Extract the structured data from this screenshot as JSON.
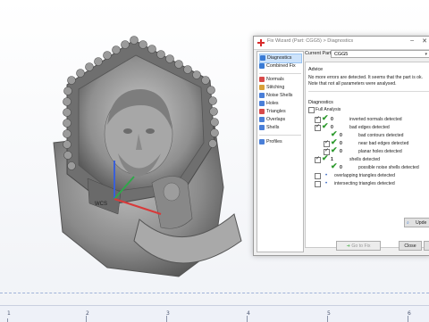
{
  "dialog": {
    "title": "Fix Wizard (Part: CGG5) > Diagnostics",
    "minimize": "–",
    "close": "✕"
  },
  "nav": {
    "items": [
      {
        "label": "Diagnostics",
        "selected": true,
        "color": "#3a7bd5"
      },
      {
        "label": "Combined Fix",
        "color": "#3a7bd5"
      },
      {
        "label": "Normals",
        "color": "#d84a4a"
      },
      {
        "label": "Stitching",
        "color": "#d8a13a"
      },
      {
        "label": "Noise Shells",
        "color": "#4a7fd8"
      },
      {
        "label": "Holes",
        "color": "#4a7fd8"
      },
      {
        "label": "Triangles",
        "color": "#d84a4a"
      },
      {
        "label": "Overlaps",
        "color": "#4a7fd8"
      },
      {
        "label": "Shells",
        "color": "#4a7fd8"
      },
      {
        "label": "Profiles",
        "color": "#4a7fd8"
      }
    ]
  },
  "current_part": {
    "label": "Current Part:",
    "value": "CGG5"
  },
  "advice": {
    "heading": "Advice",
    "text": "No more errors are detected. It seems that the part is ok. Note that not all parameters were analysed."
  },
  "diagnostics": {
    "heading": "Diagnostics",
    "full_analysis": "Full Analysis",
    "rows": [
      {
        "label": "inverted normals detected",
        "count": "0",
        "ok": true,
        "indent": 0
      },
      {
        "label": "bad edges detected",
        "count": "0",
        "ok": true,
        "indent": 0
      },
      {
        "label": "bad contours detected",
        "count": "0",
        "ok": true,
        "indent": 1
      },
      {
        "label": "near bad edges detected",
        "count": "0",
        "ok": true,
        "indent": 1
      },
      {
        "label": "planar holes detected",
        "count": "0",
        "ok": true,
        "indent": 1
      },
      {
        "label": "shells detected",
        "count": "1",
        "ok": true,
        "indent": 0
      },
      {
        "label": "possible noise shells detected",
        "count": "0",
        "ok": true,
        "indent": 1
      },
      {
        "label": "overlapping triangles detected",
        "count": "",
        "ok": false,
        "indent": 0
      },
      {
        "label": "intersecting triangles detected",
        "count": "",
        "ok": false,
        "indent": 0
      }
    ],
    "update_button": "Upde"
  },
  "buttons": {
    "go_to_fix": "Go to Fix",
    "close": "Close"
  },
  "axis_label": "WCS",
  "ruler": {
    "numbers": [
      "1",
      "2",
      "3",
      "4",
      "5",
      "6"
    ]
  },
  "colors": {
    "check": "#2e9a2e",
    "selection": "#cde3fb",
    "ring_metal": "#8e8e8e"
  }
}
